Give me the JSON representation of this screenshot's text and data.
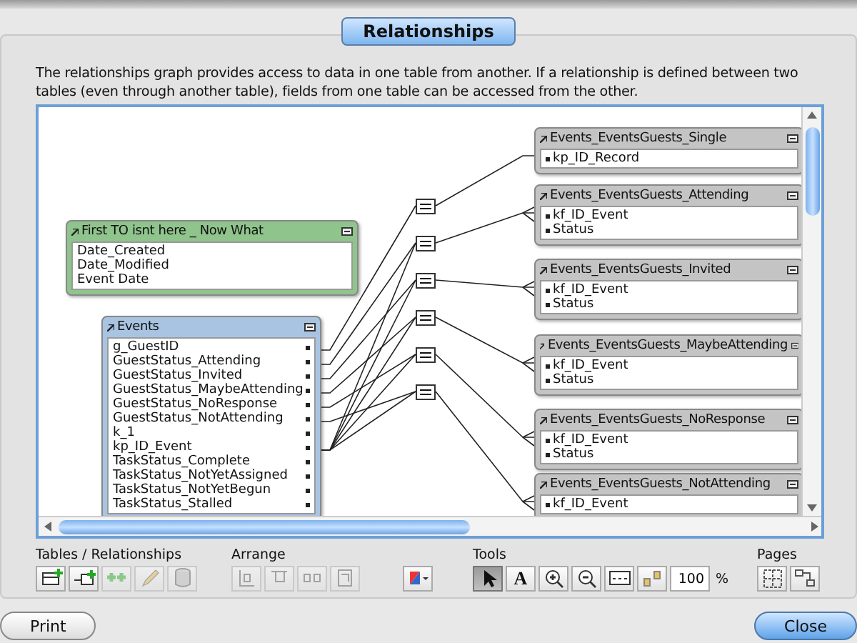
{
  "tab": {
    "label": "Relationships",
    "selected": true
  },
  "description": "The relationships graph provides access to data in one table from another. If a relationship is defined between two tables (even through another table), fields from one table can be accessed from the other.",
  "graph": {
    "tables": [
      {
        "name": "First TO isnt here _ Now What",
        "color": "#8fc48c",
        "fields": [
          "Date_Created",
          "Date_Modified",
          "Event Date"
        ]
      },
      {
        "name": "Events",
        "color": "#a9c4e2",
        "fields": [
          "g_GuestID",
          "GuestStatus_Attending",
          "GuestStatus_Invited",
          "GuestStatus_MaybeAttending",
          "GuestStatus_NoResponse",
          "GuestStatus_NotAttending",
          "k_1",
          "kp_ID_Event",
          "TaskStatus_Complete",
          "TaskStatus_NotYetAssigned",
          "TaskStatus_NotYetBegun",
          "TaskStatus_Stalled"
        ]
      },
      {
        "name": "Events_EventsGuests_Single",
        "color": "#c4c4c4",
        "fields": [
          "kp_ID_Record"
        ]
      },
      {
        "name": "Events_EventsGuests_Attending",
        "color": "#c4c4c4",
        "fields": [
          "kf_ID_Event",
          "Status"
        ]
      },
      {
        "name": "Events_EventsGuests_Invited",
        "color": "#c4c4c4",
        "fields": [
          "kf_ID_Event",
          "Status"
        ]
      },
      {
        "name": "Events_EventsGuests_MaybeAttending",
        "color": "#c4c4c4",
        "fields": [
          "kf_ID_Event",
          "Status"
        ]
      },
      {
        "name": "Events_EventsGuests_NoResponse",
        "color": "#c4c4c4",
        "fields": [
          "kf_ID_Event",
          "Status"
        ]
      },
      {
        "name": "Events_EventsGuests_NotAttending",
        "color": "#c4c4c4",
        "fields": [
          "kf_ID_Event"
        ]
      }
    ]
  },
  "toolbar": [
    {
      "label": "Tables / Relationships",
      "tools": [
        {
          "disabled": false
        },
        {
          "disabled": false
        },
        {
          "disabled": true
        },
        {
          "disabled": true
        },
        {
          "disabled": true
        }
      ]
    },
    {
      "label": "Arrange",
      "tools": [
        {
          "disabled": true
        },
        {
          "disabled": true
        },
        {
          "disabled": true
        },
        {
          "disabled": true
        }
      ]
    },
    {
      "tools": [
        {
          "disabled": false
        }
      ]
    },
    {
      "label": "Tools",
      "tools": [
        {
          "selected": true
        },
        {
          "selected": false,
          "glyph": "A"
        },
        {
          "selected": false
        },
        {
          "selected": false
        },
        {
          "selected": false
        },
        {
          "selected": false
        }
      ],
      "zoom": {
        "value": "100",
        "unit": "%"
      }
    },
    {
      "label": "Pages",
      "tools": [
        {
          "disabled": false
        },
        {
          "disabled": false
        }
      ]
    }
  ],
  "buttons": [
    {
      "label": "Print",
      "default": false
    },
    {
      "label": "Close",
      "default": true
    }
  ]
}
